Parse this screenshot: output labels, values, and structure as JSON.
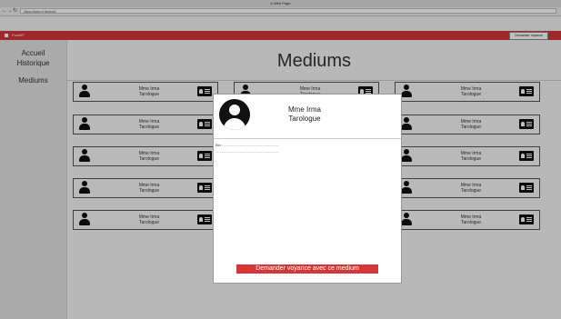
{
  "browser": {
    "window_title": "A Web Page",
    "url": "https://www.m.fixedurls"
  },
  "app": {
    "brand": "PosetIF",
    "request_button": "Demander Voyance"
  },
  "sidebar": {
    "items": [
      {
        "label": "Accueil"
      },
      {
        "label": "Historique"
      },
      {
        "label": "Mediums"
      }
    ]
  },
  "page": {
    "title": "Mediums"
  },
  "mediums": [
    {
      "name": "Mme Irma",
      "role": "Tarologue"
    },
    {
      "name": "Mme Irma",
      "role": "Tarologue"
    },
    {
      "name": "Mme Irma",
      "role": "Tarologue"
    },
    {
      "name": "Mme Irma",
      "role": "Tarologue"
    },
    {
      "name": "Mme Irma",
      "role": "Tarologue"
    },
    {
      "name": "Mme Irma",
      "role": "Tarologue"
    },
    {
      "name": "Mme Irma",
      "role": "Tarologue"
    },
    {
      "name": "Mme Irma",
      "role": "Tarologue"
    },
    {
      "name": "Mme Irma",
      "role": "Tarologue"
    },
    {
      "name": "Mme Irma",
      "role": "Tarologue"
    },
    {
      "name": "Mme Irma",
      "role": "Tarologue"
    },
    {
      "name": "Mme Irma",
      "role": "Tarologue"
    },
    {
      "name": "Mme Irma",
      "role": "Tarologue"
    },
    {
      "name": "Mme Irma",
      "role": "Tarologue"
    },
    {
      "name": "Mme Irma",
      "role": "Tarologue"
    }
  ],
  "modal": {
    "name": "Mme Irma",
    "role": "Tarologue",
    "bio_line1": "Bio : ......................................................",
    "bio_line2": "..............................................................",
    "cta": "Demander voyance avec ce medium"
  },
  "colors": {
    "accent": "#d63638"
  }
}
